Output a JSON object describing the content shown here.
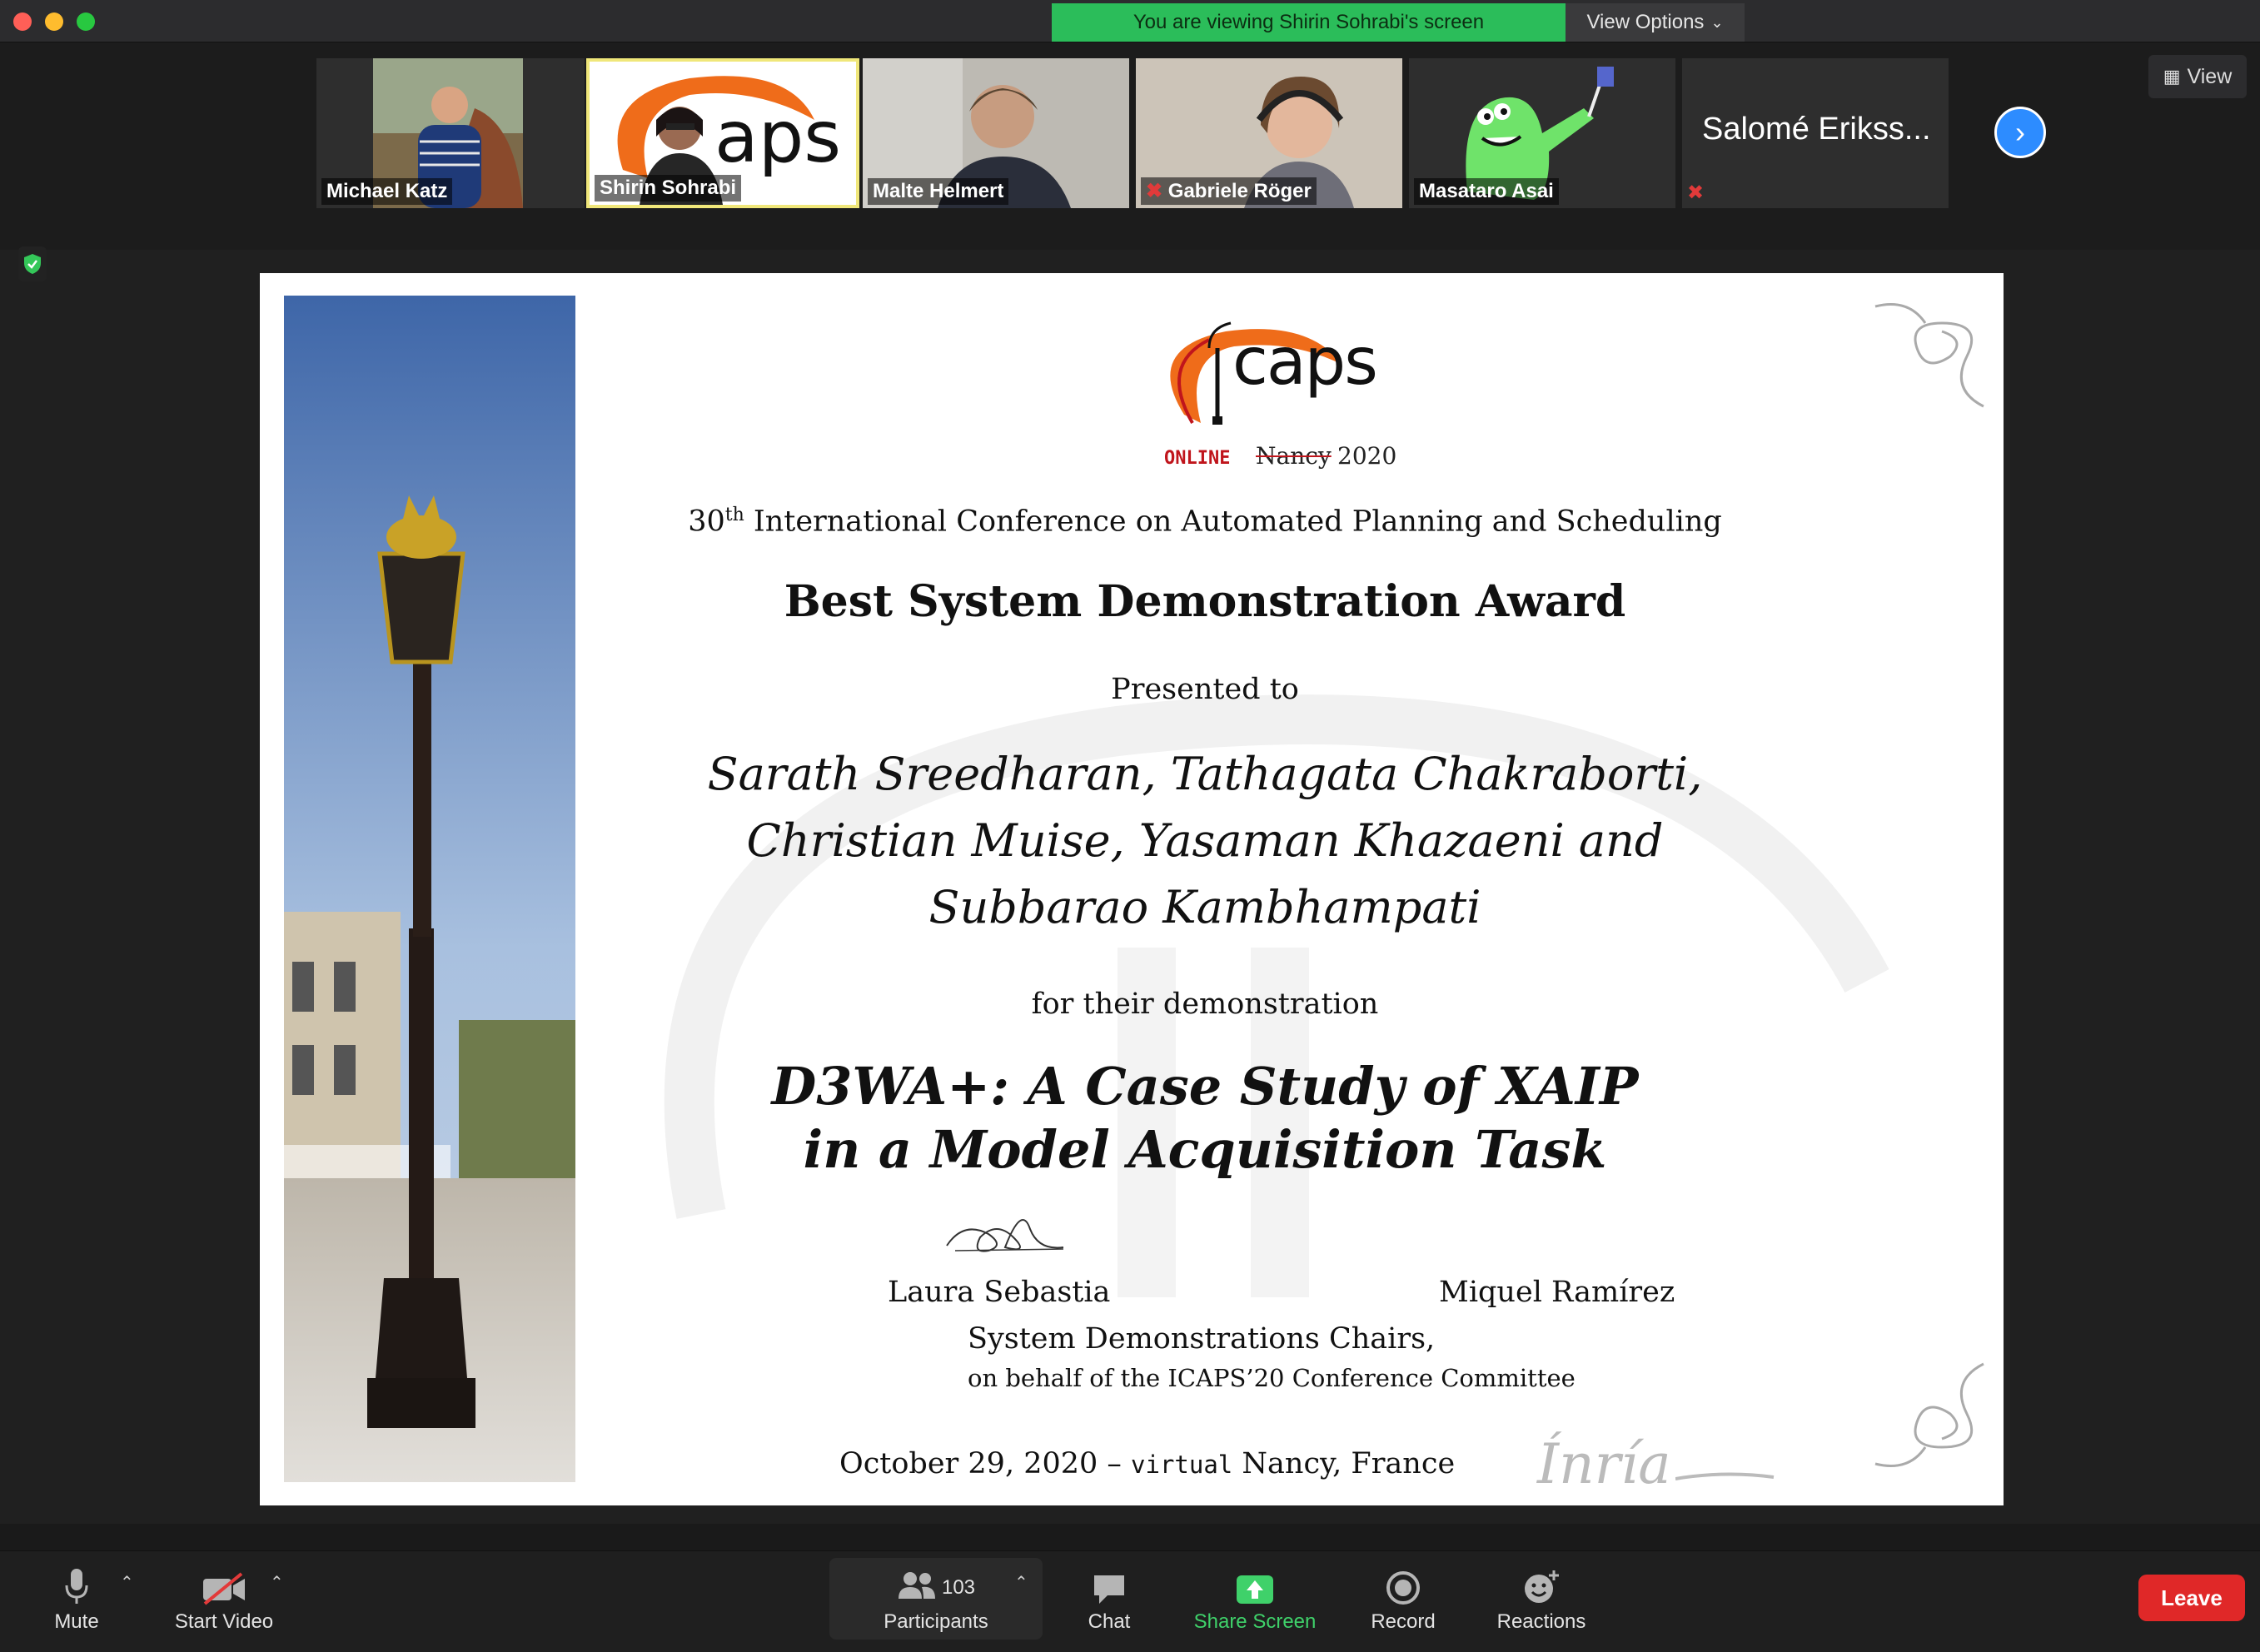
{
  "meeting": {
    "banner": "You are viewing Shirin Sohrabi's screen",
    "view_options": "View Options",
    "view_button": "View"
  },
  "participants_strip": [
    {
      "name": "Michael Katz",
      "muted": false
    },
    {
      "name": "Shirin Sohrabi",
      "muted": false,
      "active_speaker": true
    },
    {
      "name": "Malte Helmert",
      "muted": false
    },
    {
      "name": "Gabriele Röger",
      "muted": true
    },
    {
      "name": "Masataro Asai",
      "muted": false
    },
    {
      "name": "Salomé Erikss...",
      "muted": true
    }
  ],
  "certificate": {
    "logo_word": "caps",
    "logo_online": "ONLINE",
    "logo_city": "Nancy",
    "logo_year": "2020",
    "ordinal_num": "30",
    "ordinal_suffix": "th",
    "conference": "International Conference on Automated Planning and Scheduling",
    "award": "Best System Demonstration Award",
    "presented_to": "Presented to",
    "recipients_line1": "Sarath Sreedharan, Tathagata Chakraborti,",
    "recipients_line2": "Christian Muise, Yasaman Khazaeni and",
    "recipients_line3": "Subbarao Kambhampati",
    "for_their": "for their demonstration",
    "title_line1": "D3WA+: A Case Study of XAIP",
    "title_line2": "in a Model Acquisition Task",
    "signer1": "Laura Sebastia",
    "signer2": "Miquel Ramírez",
    "chairs": "System Demonstrations Chairs,",
    "behalf": "on behalf of the ICAPS’20 Conference Committee",
    "date": "October 29, 2020 –",
    "virtual": "virtual",
    "place": "Nancy, France",
    "inria": "Ínría"
  },
  "toolbar": {
    "mute": "Mute",
    "start_video": "Start Video",
    "participants": "Participants",
    "participants_count": "103",
    "chat": "Chat",
    "share_screen": "Share Screen",
    "record": "Record",
    "reactions": "Reactions",
    "leave": "Leave"
  },
  "colors": {
    "banner_green": "#2bbd5a",
    "share_green": "#3fd16a",
    "leave_red": "#e02828",
    "icaps_orange": "#ef6c1a",
    "icaps_red": "#c0151c"
  }
}
